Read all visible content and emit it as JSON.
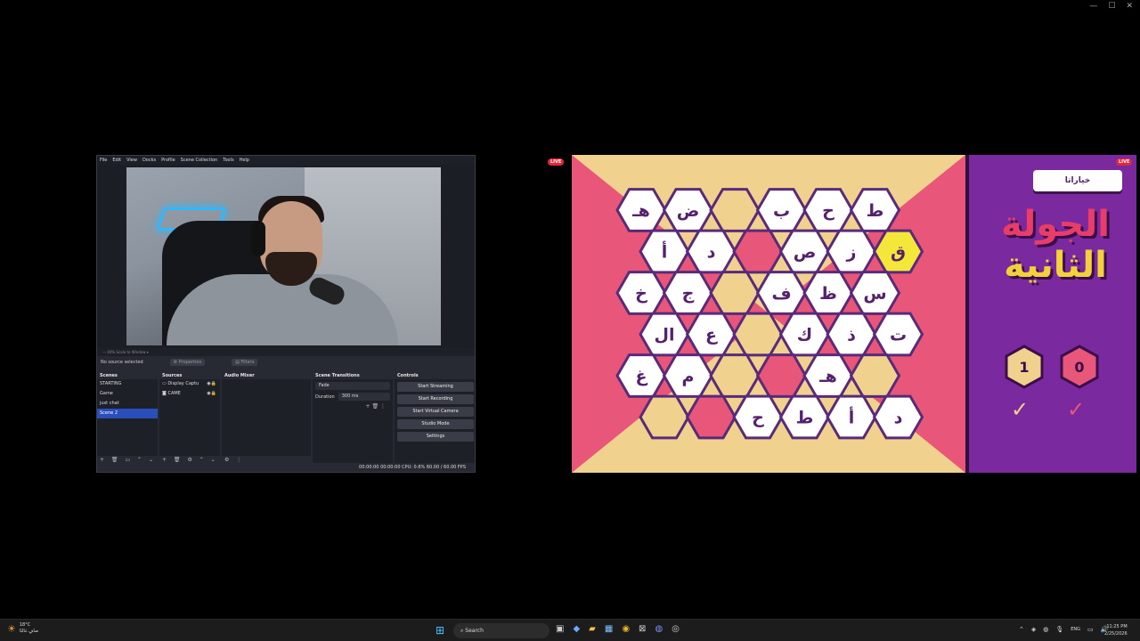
{
  "obs": {
    "menu": [
      "File",
      "Edit",
      "View",
      "Docks",
      "Profile",
      "Scene Collection",
      "Tools",
      "Help"
    ],
    "preview_bar": "—  40%       Scale to Window     ▾",
    "no_source": "No source selected",
    "properties_label": "Properties",
    "filters_label": "Filters",
    "docks": {
      "scenes": {
        "title": "Scenes",
        "items": [
          "STARTING",
          "Game",
          "just chat",
          "Scene 2"
        ]
      },
      "sources": {
        "title": "Sources",
        "items": [
          "Display Captu",
          "CAME"
        ]
      },
      "audio": {
        "title": "Audio Mixer"
      },
      "transitions": {
        "title": "Scene Transitions",
        "type": "Fade",
        "duration_label": "Duration",
        "duration_value": "300 ms"
      },
      "controls": {
        "title": "Controls",
        "buttons": [
          "Start Streaming",
          "Start Recording",
          "Start Virtual Camera",
          "Studio Mode",
          "Settings"
        ]
      }
    },
    "status": "00:00:00     00:00:00    CPU: 0.6%     60.00 / 60.00 FPS"
  },
  "live_labels": [
    "LIVE",
    "LIVE"
  ],
  "game": {
    "choices_button": "خياراتا",
    "round_line1": "الجولة",
    "round_line2": "الثانية",
    "score_left": "1",
    "score_right": "0",
    "check_mark": "✓",
    "colors": {
      "board_pink": "#e8577a",
      "board_sand": "#f0d28e",
      "purple": "#7a2a9e",
      "hex_border": "#5a2a7a",
      "yellow": "#f5e63a"
    },
    "rows": [
      [
        {
          "t": "هـ",
          "c": "w"
        },
        {
          "t": "ض",
          "c": "w"
        },
        {
          "t": "",
          "c": "s"
        },
        {
          "t": "ب",
          "c": "w"
        },
        {
          "t": "ح",
          "c": "w"
        },
        {
          "t": "ط",
          "c": "w"
        }
      ],
      [
        {
          "t": "أ",
          "c": "w"
        },
        {
          "t": "د",
          "c": "w"
        },
        {
          "t": "",
          "c": "p"
        },
        {
          "t": "ص",
          "c": "w"
        },
        {
          "t": "ز",
          "c": "w"
        },
        {
          "t": "ق",
          "c": "y"
        }
      ],
      [
        {
          "t": "خ",
          "c": "w"
        },
        {
          "t": "ج",
          "c": "w"
        },
        {
          "t": "",
          "c": "s"
        },
        {
          "t": "ف",
          "c": "w"
        },
        {
          "t": "ظ",
          "c": "w"
        },
        {
          "t": "س",
          "c": "w"
        }
      ],
      [
        {
          "t": "ال",
          "c": "w"
        },
        {
          "t": "ع",
          "c": "w"
        },
        {
          "t": "",
          "c": "s"
        },
        {
          "t": "ك",
          "c": "w"
        },
        {
          "t": "ذ",
          "c": "w"
        },
        {
          "t": "ت",
          "c": "w"
        }
      ],
      [
        {
          "t": "غ",
          "c": "w"
        },
        {
          "t": "م",
          "c": "w"
        },
        {
          "t": "",
          "c": "s"
        },
        {
          "t": "",
          "c": "p"
        },
        {
          "t": "هـ",
          "c": "w"
        },
        {
          "t": "",
          "c": "s"
        }
      ],
      [
        {
          "t": "",
          "c": "s"
        },
        {
          "t": "",
          "c": "p"
        },
        {
          "t": "ح",
          "c": "w"
        },
        {
          "t": "ط",
          "c": "w"
        },
        {
          "t": "أ",
          "c": "w"
        },
        {
          "t": "د",
          "c": "w"
        }
      ]
    ]
  },
  "taskbar": {
    "weather_temp": "18°C",
    "weather_text": "صافٍ غالبًا",
    "search_placeholder": "Search",
    "lang": "ENG",
    "time": "11:25 PM",
    "date": "2/25/2026"
  }
}
